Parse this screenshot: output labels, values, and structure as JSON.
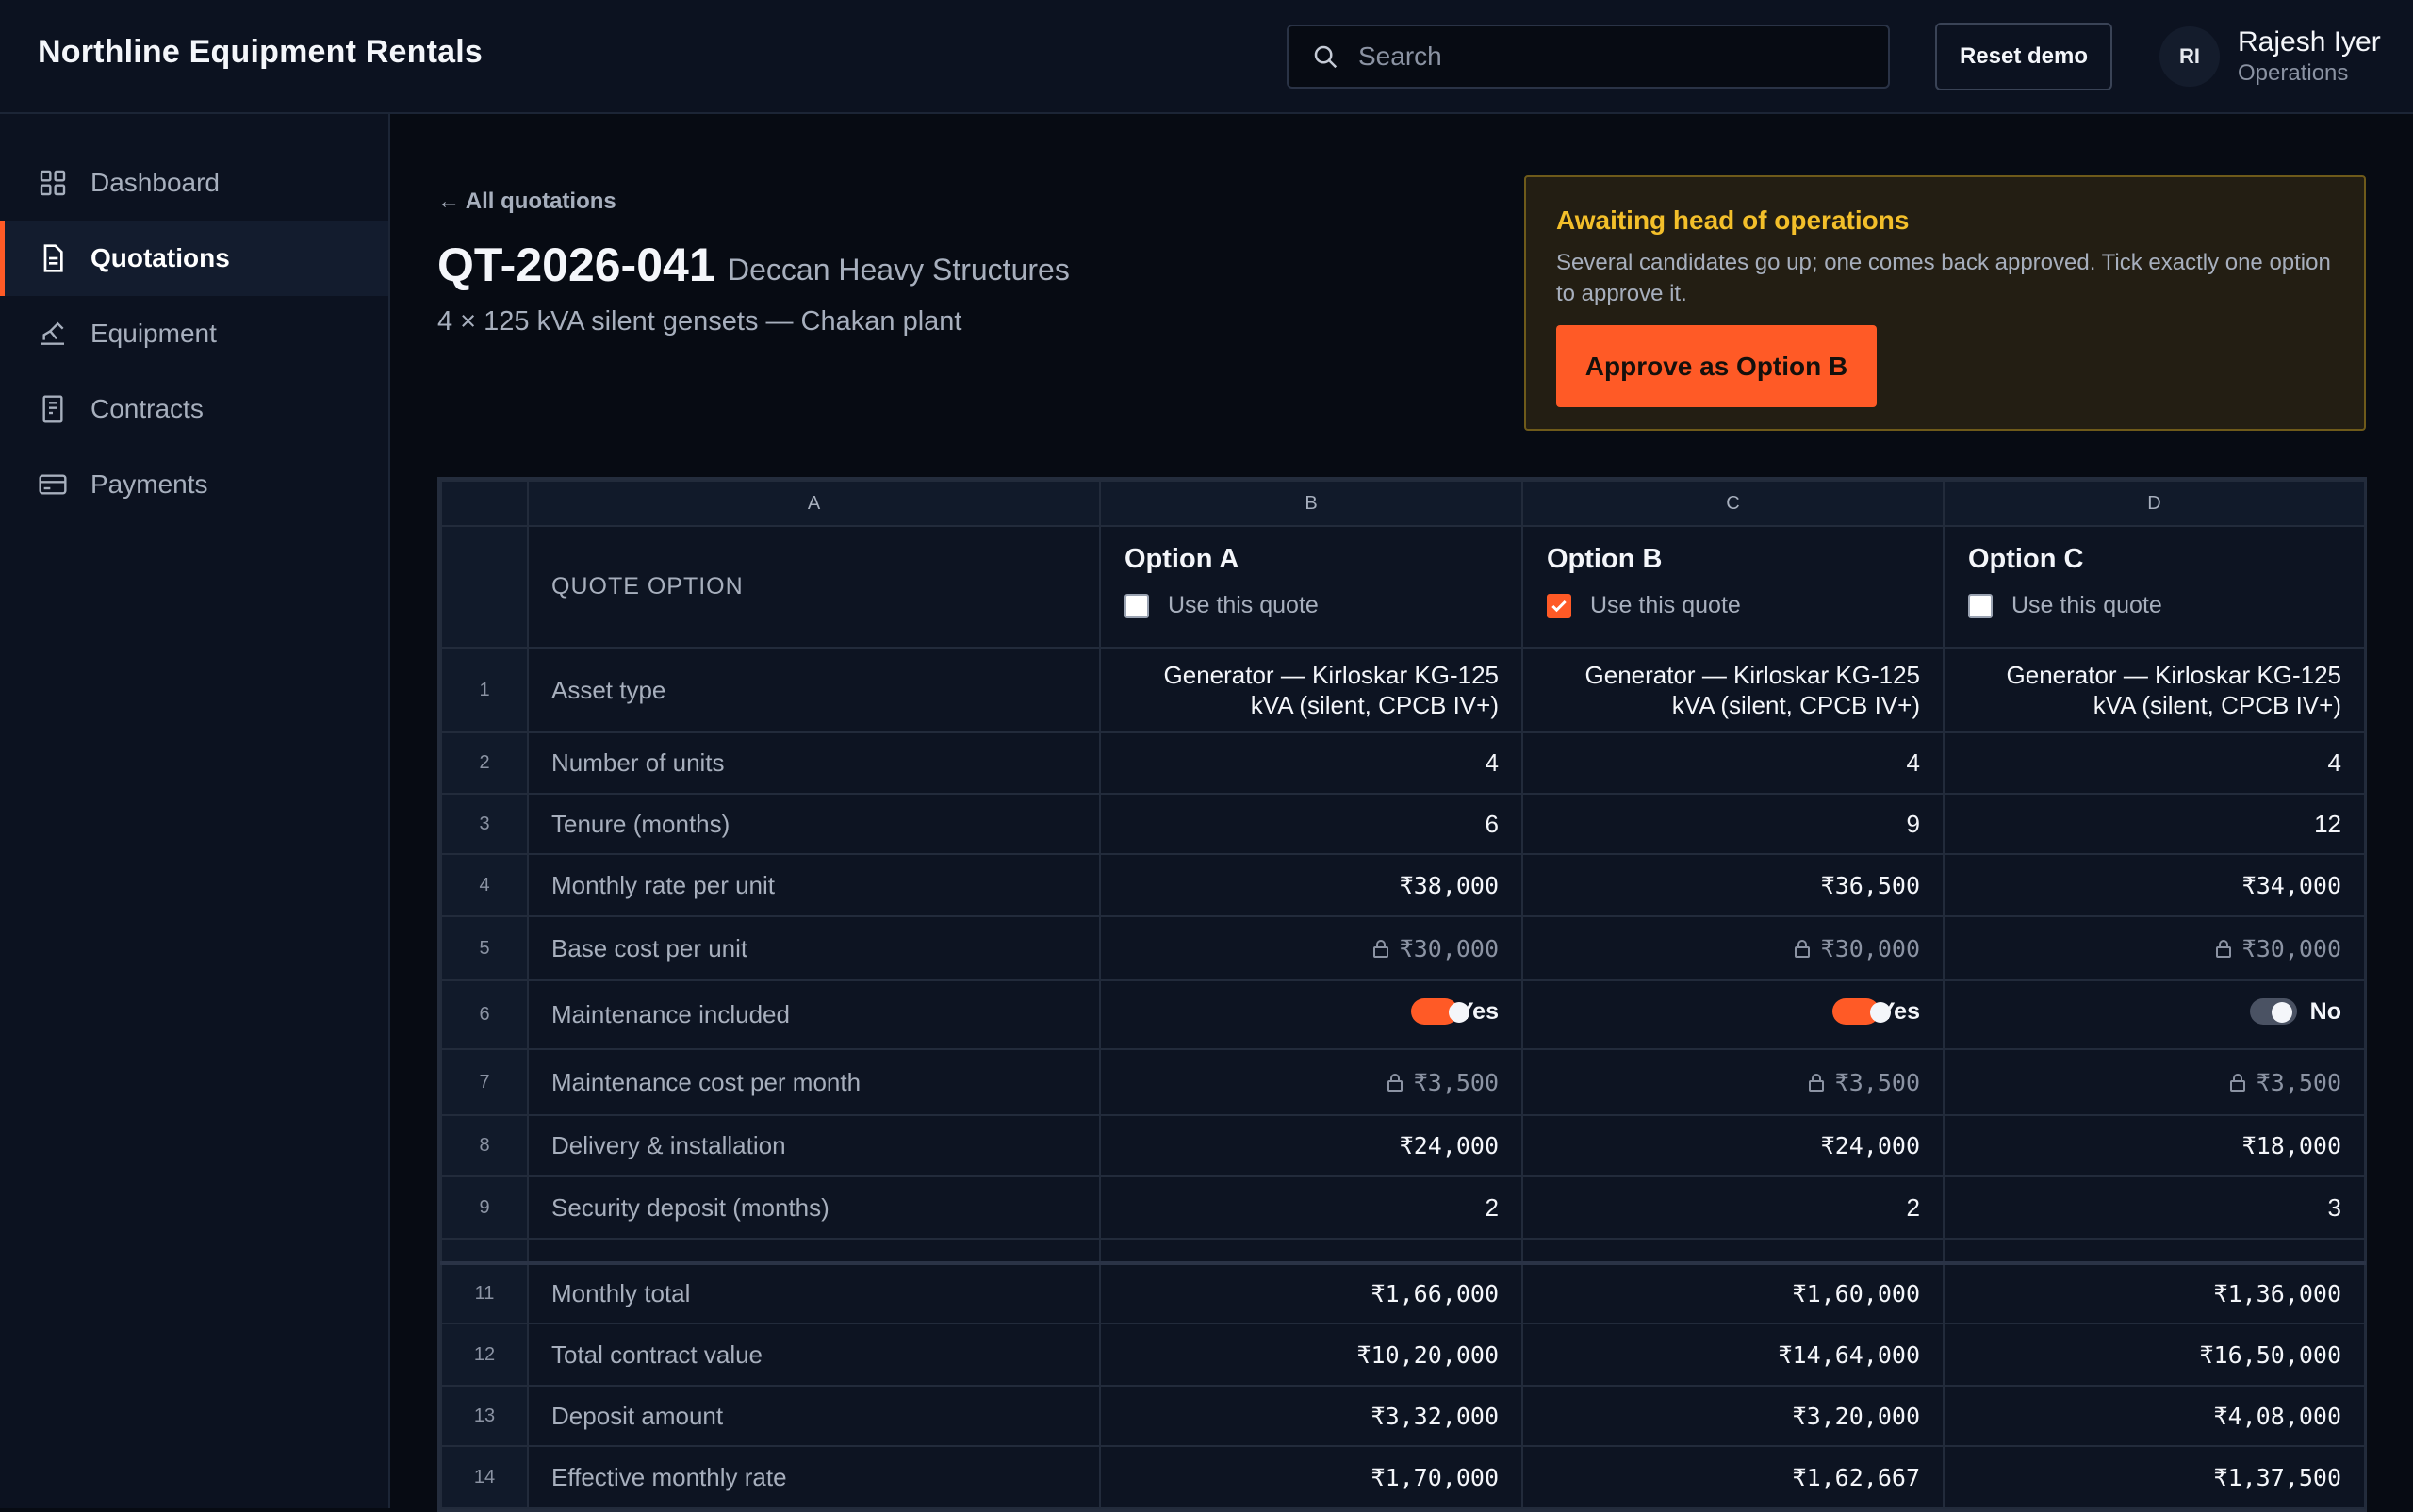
{
  "app": {
    "brand": "Northline Equipment Rentals",
    "search_placeholder": "Search",
    "reset_label": "Reset demo",
    "user": {
      "initials": "RI",
      "name": "Rajesh Iyer",
      "role": "Operations"
    }
  },
  "sidebar": {
    "items": [
      {
        "label": "Dashboard",
        "icon": "dashboard-grid-icon",
        "active": false
      },
      {
        "label": "Quotations",
        "icon": "document-icon",
        "active": true
      },
      {
        "label": "Equipment",
        "icon": "excavator-icon",
        "active": false
      },
      {
        "label": "Contracts",
        "icon": "contract-icon",
        "active": false
      },
      {
        "label": "Payments",
        "icon": "credit-card-icon",
        "active": false
      }
    ]
  },
  "header": {
    "back_label": "← All quotations",
    "quote_id": "QT-2026-041",
    "client": "Deccan Heavy Structures",
    "subtitle": "4 × 125 kVA silent gensets — Chakan plant"
  },
  "approval": {
    "title": "Awaiting head of operations",
    "text": "Several candidates go up; one comes back approved. Tick exactly one option to approve it.",
    "button_label": "Approve as Option B"
  },
  "grid": {
    "column_letters": [
      "A",
      "B",
      "C",
      "D"
    ],
    "option_label": "QUOTE OPTION",
    "use_quote_label": "Use this quote",
    "options": [
      {
        "name": "Option A",
        "checked": false
      },
      {
        "name": "Option B",
        "checked": true
      },
      {
        "name": "Option C",
        "checked": false
      }
    ],
    "rows": [
      {
        "num": "1",
        "label": "Asset type",
        "values": [
          "Generator — Kirloskar KG-125 kVA (silent, CPCB IV+)",
          "Generator — Kirloskar KG-125 kVA (silent, CPCB IV+)",
          "Generator — Kirloskar KG-125 kVA (silent, CPCB IV+)"
        ]
      },
      {
        "num": "2",
        "label": "Number of units",
        "values": [
          "4",
          "4",
          "4"
        ]
      },
      {
        "num": "3",
        "label": "Tenure (months)",
        "values": [
          "6",
          "9",
          "12"
        ]
      },
      {
        "num": "4",
        "label": "Monthly rate per unit",
        "values": [
          "₹38,000",
          "₹36,500",
          "₹34,000"
        ]
      },
      {
        "num": "5",
        "label": "Base cost per unit",
        "values": [
          "₹30,000",
          "₹30,000",
          "₹30,000"
        ]
      },
      {
        "num": "6",
        "label": "Maintenance included",
        "values": [
          "Yes",
          "Yes",
          "No"
        ]
      },
      {
        "num": "7",
        "label": "Maintenance cost per month",
        "values": [
          "₹3,500",
          "₹3,500",
          "₹3,500"
        ]
      },
      {
        "num": "8",
        "label": "Delivery & installation",
        "values": [
          "₹24,000",
          "₹24,000",
          "₹18,000"
        ]
      },
      {
        "num": "9",
        "label": "Security deposit (months)",
        "values": [
          "2",
          "2",
          "3"
        ]
      },
      {
        "num": "11",
        "label": "Monthly total",
        "values": [
          "₹1,66,000",
          "₹1,60,000",
          "₹1,36,000"
        ]
      },
      {
        "num": "12",
        "label": "Total contract value",
        "values": [
          "₹10,20,000",
          "₹14,64,000",
          "₹16,50,000"
        ]
      },
      {
        "num": "13",
        "label": "Deposit amount",
        "values": [
          "₹3,32,000",
          "₹3,20,000",
          "₹4,08,000"
        ]
      },
      {
        "num": "14",
        "label": "Effective monthly rate",
        "values": [
          "₹1,70,000",
          "₹1,62,667",
          "₹1,37,500"
        ]
      }
    ]
  },
  "colors": {
    "accent": "#ff5a26",
    "warning": "#f3bf2a",
    "background": "#070b13",
    "panel": "#0c1220"
  }
}
